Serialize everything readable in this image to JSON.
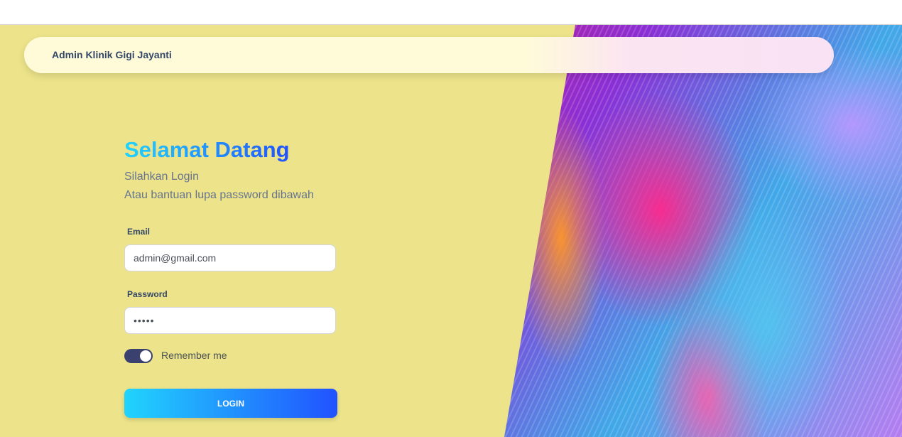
{
  "navbar": {
    "brand": "Admin Klinik Gigi Jayanti"
  },
  "login": {
    "title": "Selamat Datang",
    "subtitle_1": "Silahkan Login",
    "subtitle_2": "Atau bantuan lupa password dibawah",
    "email_label": "Email",
    "email_value": "admin@gmail.com",
    "password_label": "Password",
    "password_value": "•••••",
    "remember_label": "Remember me",
    "remember_on": true,
    "button_label": "LOGIN"
  }
}
